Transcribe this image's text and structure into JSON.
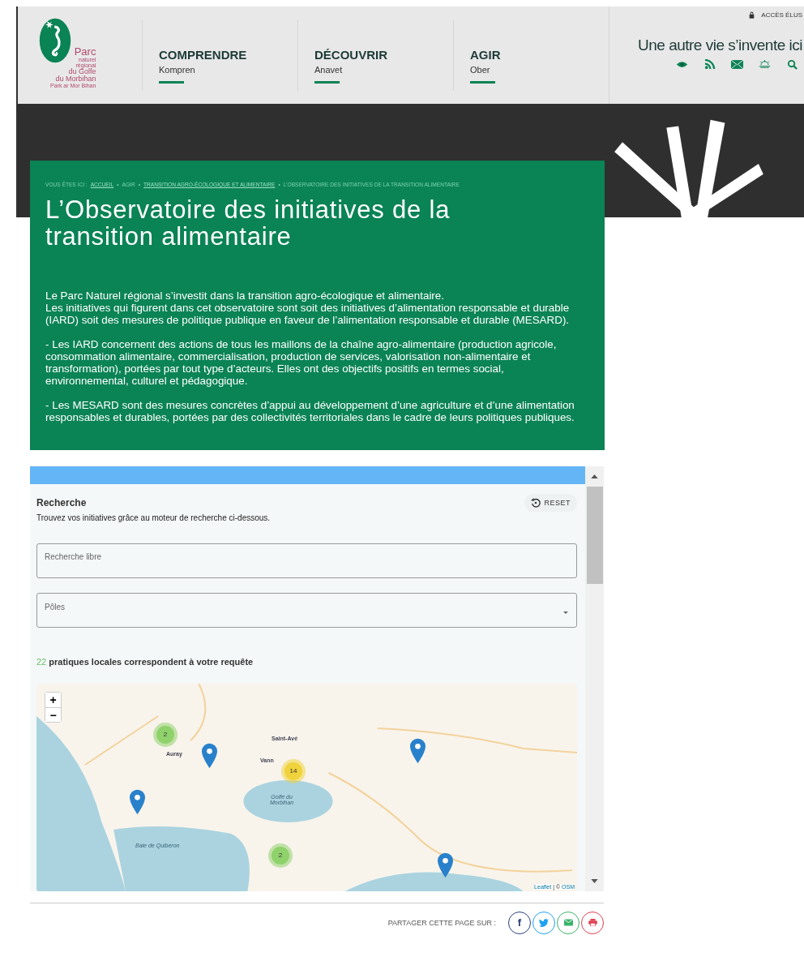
{
  "header": {
    "logo_lines": [
      "Parc",
      "naturel",
      "régional",
      "du Golfe",
      "du Morbihan",
      "Park ar Mor Bihan"
    ],
    "nav": [
      {
        "label": "COMPRENDRE",
        "sub": "Kompren"
      },
      {
        "label": "DÉCOUVRIR",
        "sub": "Anavet"
      },
      {
        "label": "AGIR",
        "sub": "Ober"
      }
    ],
    "access_link": "ACCÈS ÉLUS",
    "tagline": "Une autre vie s’invente ici"
  },
  "intro": {
    "separator": "•",
    "breadcrumb": [
      {
        "label": "VOUS ÊTES ICI :",
        "kind": "text"
      },
      {
        "label": "ACCUEIL",
        "kind": "link"
      },
      {
        "label": "AGIR",
        "kind": "text"
      },
      {
        "label": "TRANSITION AGRO-ÉCOLOGIQUE ET ALIMENTAIRE",
        "kind": "link"
      },
      {
        "label": "L’OBSERVATOIRE DES INITIATIVES DE LA TRANSITION ALIMENTAIRE",
        "kind": "text"
      }
    ],
    "title": "L’Observatoire des initiatives de la transition alimentaire",
    "paragraphs": [
      "Le Parc Naturel régional s’investit dans la transition agro-écologique et alimentaire.\nLes initiatives qui figurent dans cet observatoire sont soit des initiatives d’alimentation responsable et durable (IARD) soit des mesures de politique publique en faveur de l’alimentation responsable et durable (MESARD).",
      "- Les IARD concernent des actions de tous les maillons de la chaîne agro-alimentaire (production agricole, consommation alimentaire, commercialisation, production de services, valorisation non-alimentaire et transformation), portées par tout type d’acteurs. Elles ont des objectifs positifs en termes social, environnemental, culturel et pédagogique.",
      "- Les MESARD sont des mesures concrètes d’appui au développement d’une agriculture et d’une alimentation responsables et durables, portées par des collectivités territoriales dans le cadre de leurs politiques publiques."
    ]
  },
  "search": {
    "title": "Recherche",
    "description": "Trouvez vos initiatives grâce au moteur de recherche ci-dessous.",
    "reset": "RESET",
    "free_text": {
      "placeholder": "Recherche libre"
    },
    "poles": {
      "placeholder": "Pôles"
    },
    "result_count": "22",
    "result_text": "pratiques locales correspondent à votre requête"
  },
  "map": {
    "zoom_in": "+",
    "zoom_out": "−",
    "places": [
      "Saint-Avé",
      "Auray",
      "Vann",
      "Golfe du\nMorbihan",
      "Baie de Quiberon"
    ],
    "markers": [
      {
        "kind": "cluster",
        "count": "2",
        "color": "#8fd16b"
      },
      {
        "kind": "pin"
      },
      {
        "kind": "pin"
      },
      {
        "kind": "cluster",
        "count": "14",
        "color": "#f0d23c"
      },
      {
        "kind": "pin"
      },
      {
        "kind": "cluster",
        "count": "2",
        "color": "#8fd16b"
      },
      {
        "kind": "pin"
      }
    ],
    "attribution_link": "Leaflet",
    "attribution_text": "| ©",
    "osm_link": "OSM"
  },
  "share": {
    "label": "PARTAGER CETTE PAGE SUR :",
    "facebook": "f"
  }
}
